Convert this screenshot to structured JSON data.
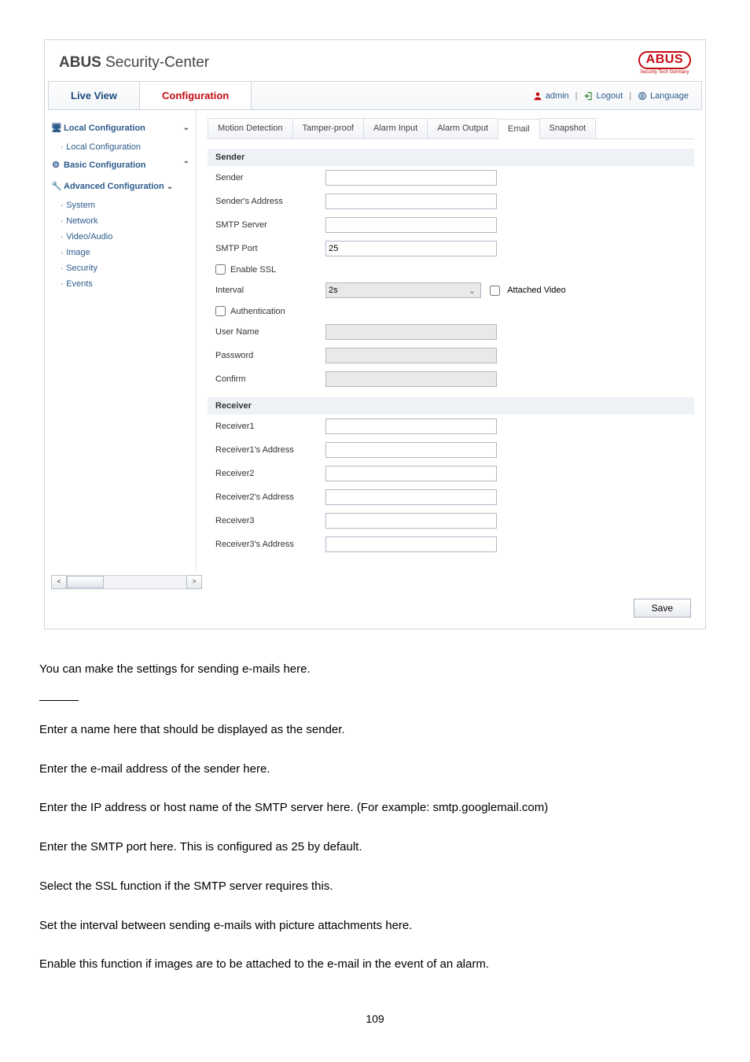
{
  "header": {
    "brand_bold": "ABUS",
    "brand_rest": " Security-Center",
    "logo_main": "ABUS",
    "logo_sub": "Security Tech Germany"
  },
  "tabs": {
    "live_view": "Live View",
    "configuration": "Configuration"
  },
  "topbar": {
    "user": "admin",
    "logout": "Logout",
    "language": "Language"
  },
  "sidebar": {
    "local_conf": "Local Configuration",
    "local_conf_sub": "Local Configuration",
    "basic_conf": "Basic Configuration",
    "advanced_conf": "Advanced Configuration",
    "advanced_items": {
      "system": "System",
      "network": "Network",
      "video_audio": "Video/Audio",
      "image": "Image",
      "security": "Security",
      "events": "Events"
    }
  },
  "minitabs": {
    "motion": "Motion Detection",
    "tamper": "Tamper-proof",
    "alarm_in": "Alarm Input",
    "alarm_out": "Alarm Output",
    "email": "Email",
    "snapshot": "Snapshot"
  },
  "sections": {
    "sender": "Sender",
    "receiver": "Receiver"
  },
  "form": {
    "sender": "Sender",
    "senders_address": "Sender's Address",
    "smtp_server": "SMTP Server",
    "smtp_port": "SMTP Port",
    "smtp_port_value": "25",
    "enable_ssl": "Enable SSL",
    "interval": "Interval",
    "interval_value": "2s",
    "attached_video": "Attached Video",
    "authentication": "Authentication",
    "user_name": "User Name",
    "password": "Password",
    "confirm": "Confirm",
    "receiver1": "Receiver1",
    "receiver1_addr": "Receiver1's Address",
    "receiver2": "Receiver2",
    "receiver2_addr": "Receiver2's Address",
    "receiver3": "Receiver3",
    "receiver3_addr": "Receiver3's Address"
  },
  "buttons": {
    "save": "Save"
  },
  "doc": {
    "p1": "You can make the settings for sending e-mails here.",
    "p2": "Enter a name here that should be displayed as the sender.",
    "p3": "Enter the e-mail address of the sender here.",
    "p4": "Enter the IP address or host name of the SMTP  server here. (For example: smtp.googlemail.com)",
    "p5": "Enter the SMTP port here. This is configured as 25 by default.",
    "p6": "Select the SSL function if the SMTP server requires this.",
    "p7": "Set the interval between sending e-mails with picture attachments here.",
    "p8": "Enable this function if images are to be attached to the e-mail in the event of an alarm.",
    "page_number": "109"
  }
}
